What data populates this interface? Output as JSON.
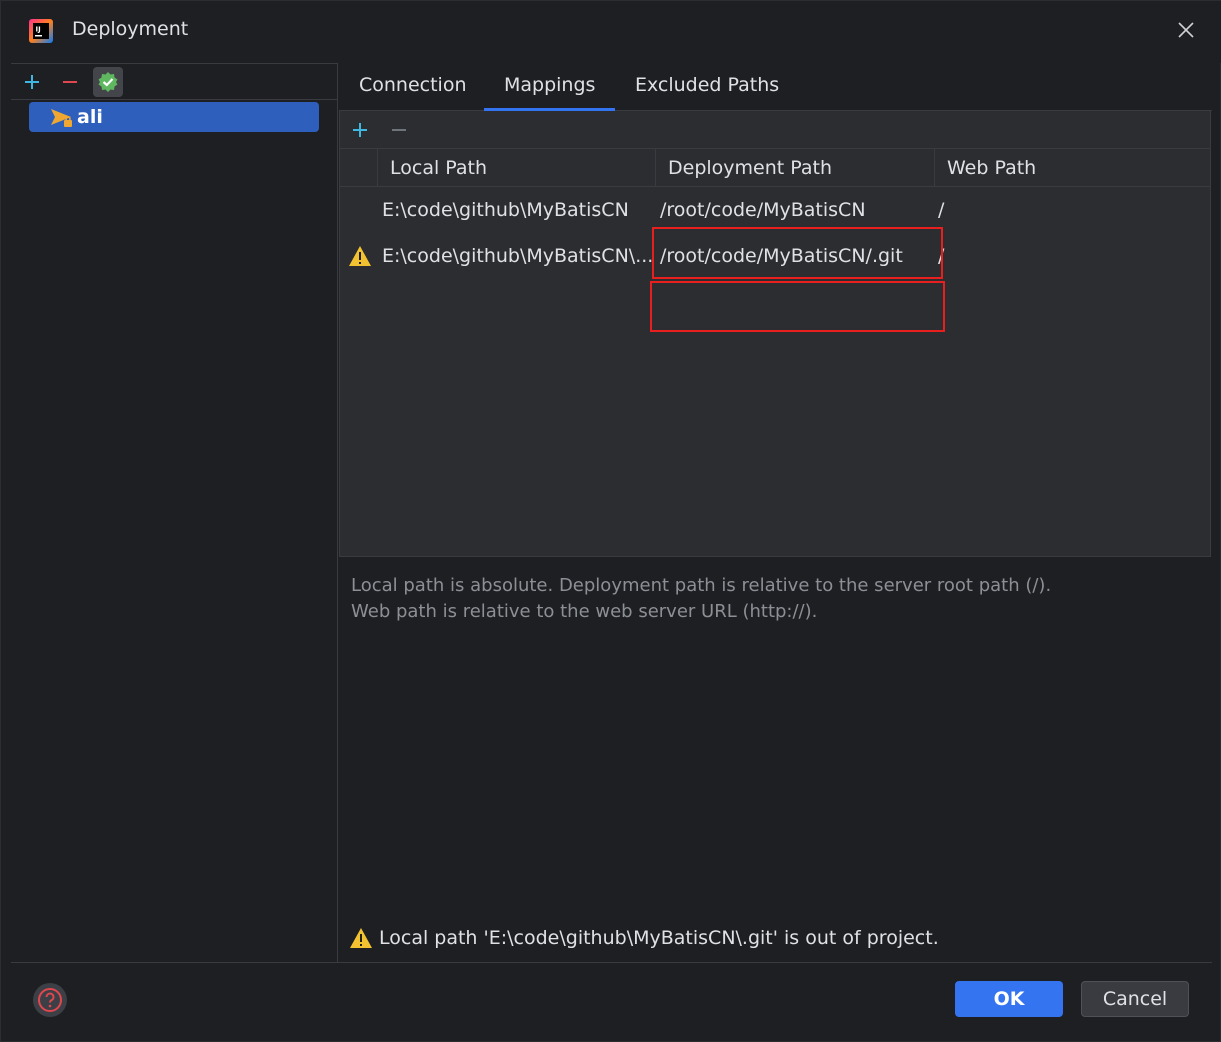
{
  "window": {
    "title": "Deployment",
    "logo_letters": "IJ"
  },
  "left_pane": {
    "toolbar": {
      "add_icon": "plus-icon",
      "remove_icon": "minus-icon",
      "default_icon": "check-badge-icon"
    },
    "servers": [
      {
        "label": "ali",
        "icon": "sftp-server-icon",
        "selected": true
      }
    ]
  },
  "tabs": [
    {
      "label": "Connection",
      "active": false
    },
    {
      "label": "Mappings",
      "active": true
    },
    {
      "label": "Excluded Paths",
      "active": false
    }
  ],
  "mappings": {
    "toolbar": {
      "add_icon": "plus-icon",
      "remove_icon": "minus-icon"
    },
    "columns": [
      "Local Path",
      "Deployment Path",
      "Web Path"
    ],
    "rows": [
      {
        "warning": false,
        "local_path": "E:\\code\\github\\MyBatisCN",
        "deployment_path": "/root/code/MyBatisCN",
        "web_path": "/"
      },
      {
        "warning": true,
        "local_path": "E:\\code\\github\\MyBatisCN\\...",
        "deployment_path": "/root/code/MyBatisCN/.git",
        "web_path": "/"
      }
    ],
    "hint_line1": "Local path is absolute. Deployment path is relative to the server root path (/).",
    "hint_line2": "Web path is relative to the web server URL (http://)."
  },
  "warning_message": "Local path 'E:\\code\\github\\MyBatisCN\\.git' is out of project.",
  "footer": {
    "help_icon": "help-icon",
    "ok_label": "OK",
    "cancel_label": "Cancel"
  },
  "colors": {
    "background": "#1e1f22",
    "panel": "#2b2d30",
    "accent": "#3574f0",
    "selection": "#2e5fbd",
    "highlight_annotation": "#e81f1f",
    "warning": "#f2c230"
  }
}
